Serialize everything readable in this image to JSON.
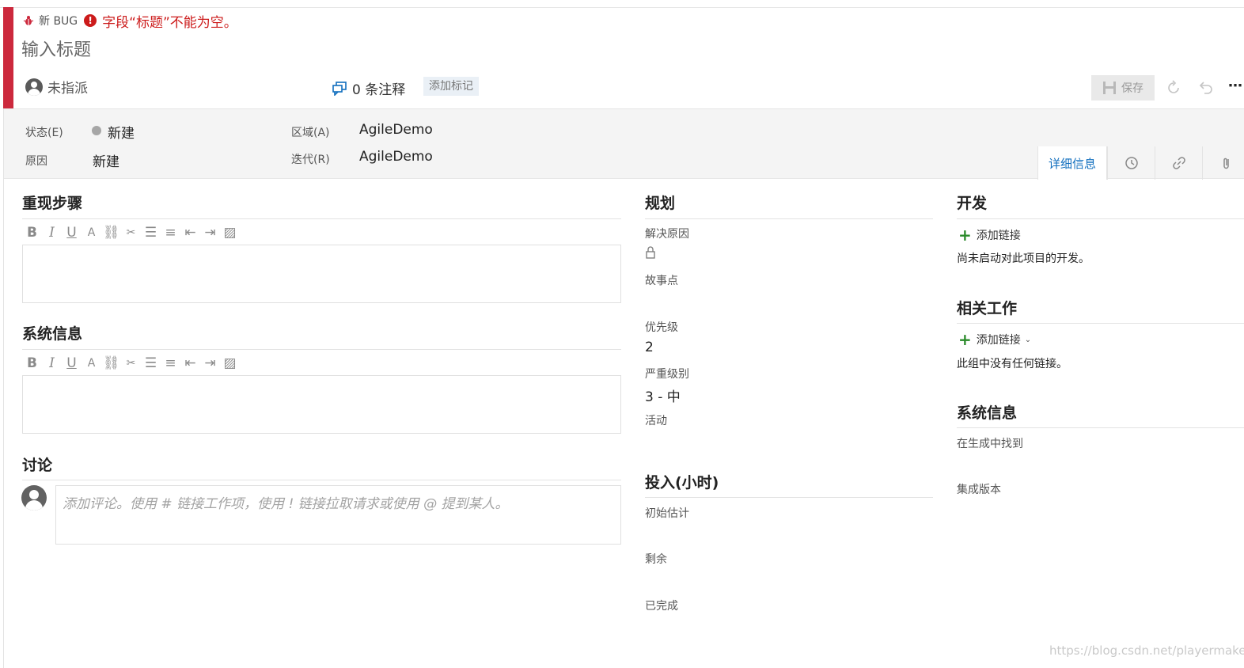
{
  "header": {
    "type_label": "新 BUG",
    "error_message": "字段“标题”不能为空。",
    "title_placeholder": "输入标题",
    "assigned_to": "未指派",
    "comment_count": "0 条注释",
    "add_tag": "添加标记",
    "save_label": "保存"
  },
  "fields": {
    "state_label": "状态(E)",
    "state_value": "新建",
    "reason_label": "原因",
    "reason_value": "新建",
    "area_label": "区域(A)",
    "area_value": "AgileDemo",
    "iteration_label": "迭代(R)",
    "iteration_value": "AgileDemo"
  },
  "tabs": {
    "details": "详细信息"
  },
  "left": {
    "repro_title": "重现步骤",
    "sysinfo_title": "系统信息",
    "discussion_title": "讨论",
    "discussion_placeholder": "添加评论。使用 # 链接工作项，使用 ! 链接拉取请求或使用 @ 提到某人。"
  },
  "planning": {
    "title": "规划",
    "resolved_reason_label": "解决原因",
    "story_points_label": "故事点",
    "priority_label": "优先级",
    "priority_value": "2",
    "severity_label": "严重级别",
    "severity_value": "3 - 中",
    "activity_label": "活动"
  },
  "effort": {
    "title": "投入(小时)",
    "original_estimate_label": "初始估计",
    "remaining_label": "剩余",
    "completed_label": "已完成"
  },
  "development": {
    "title": "开发",
    "add_link": "添加链接",
    "note": "尚未启动对此项目的开发。"
  },
  "related": {
    "title": "相关工作",
    "add_link": "添加链接",
    "note": "此组中没有任何链接。"
  },
  "system_info": {
    "title": "系统信息",
    "found_in_build_label": "在生成中找到",
    "integration_build_label": "集成版本"
  },
  "watermark": "https://blog.csdn.net/playermaker",
  "colors": {
    "bug_red": "#cc293d",
    "error_red": "#cc1b1b",
    "accent_blue": "#106ebe",
    "add_green": "#2a8a2a"
  }
}
